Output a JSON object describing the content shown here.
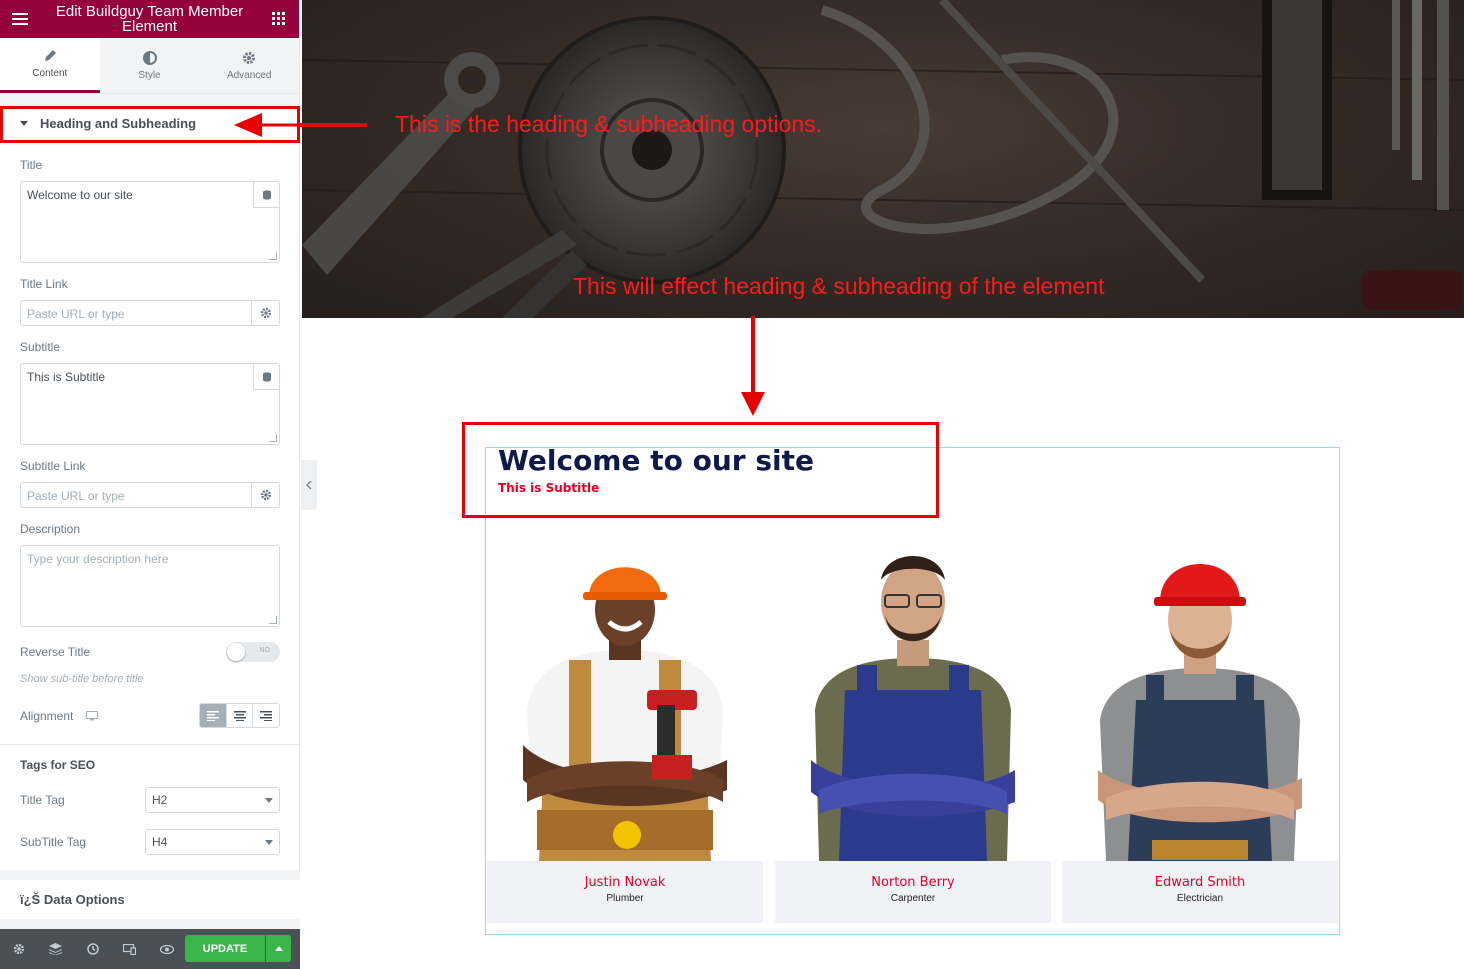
{
  "editor": {
    "title": "Edit Buildguy Team Member Element",
    "tabs": [
      {
        "label": "Content",
        "icon": "pencil-icon",
        "active": true
      },
      {
        "label": "Style",
        "icon": "half-circle-icon",
        "active": false
      },
      {
        "label": "Advanced",
        "icon": "gear-icon",
        "active": false
      }
    ],
    "section": "Heading and Subheading",
    "title_label": "Title",
    "title_value": "Welcome to our site",
    "title_link_label": "Title Link",
    "url_placeholder": "Paste URL or type",
    "subtitle_label": "Subtitle",
    "subtitle_value": "This is Subtitle",
    "subtitle_link_label": "Subtitle Link",
    "description_label": "Description",
    "description_placeholder": "Type your description here",
    "reverse_label": "Reverse Title",
    "reverse_state": "NO",
    "reverse_hint": "Show sub-title before title",
    "alignment_label": "Alignment",
    "seo_label": "Tags for SEO",
    "title_tag_label": "Title Tag",
    "title_tag_value": "H2",
    "subtitle_tag_label": "SubTitle Tag",
    "subtitle_tag_value": "H4",
    "data_options": "ï¿Š Data Options",
    "update_label": "UPDATE"
  },
  "annotations": {
    "top": "This is the heading & subheading options.",
    "middle": "This will effect heading & subheading of the element"
  },
  "preview": {
    "title": "Welcome to our site",
    "subtitle": "This is Subtitle",
    "members": [
      {
        "name": "Justin Novak",
        "role": "Plumber"
      },
      {
        "name": "Norton Berry",
        "role": "Carpenter"
      },
      {
        "name": "Edward Smith",
        "role": "Electrician"
      }
    ]
  },
  "colors": {
    "brand": "#93003c",
    "annotation": "#ff1a1a",
    "update": "#39b54a",
    "member_name": "#e60023"
  }
}
